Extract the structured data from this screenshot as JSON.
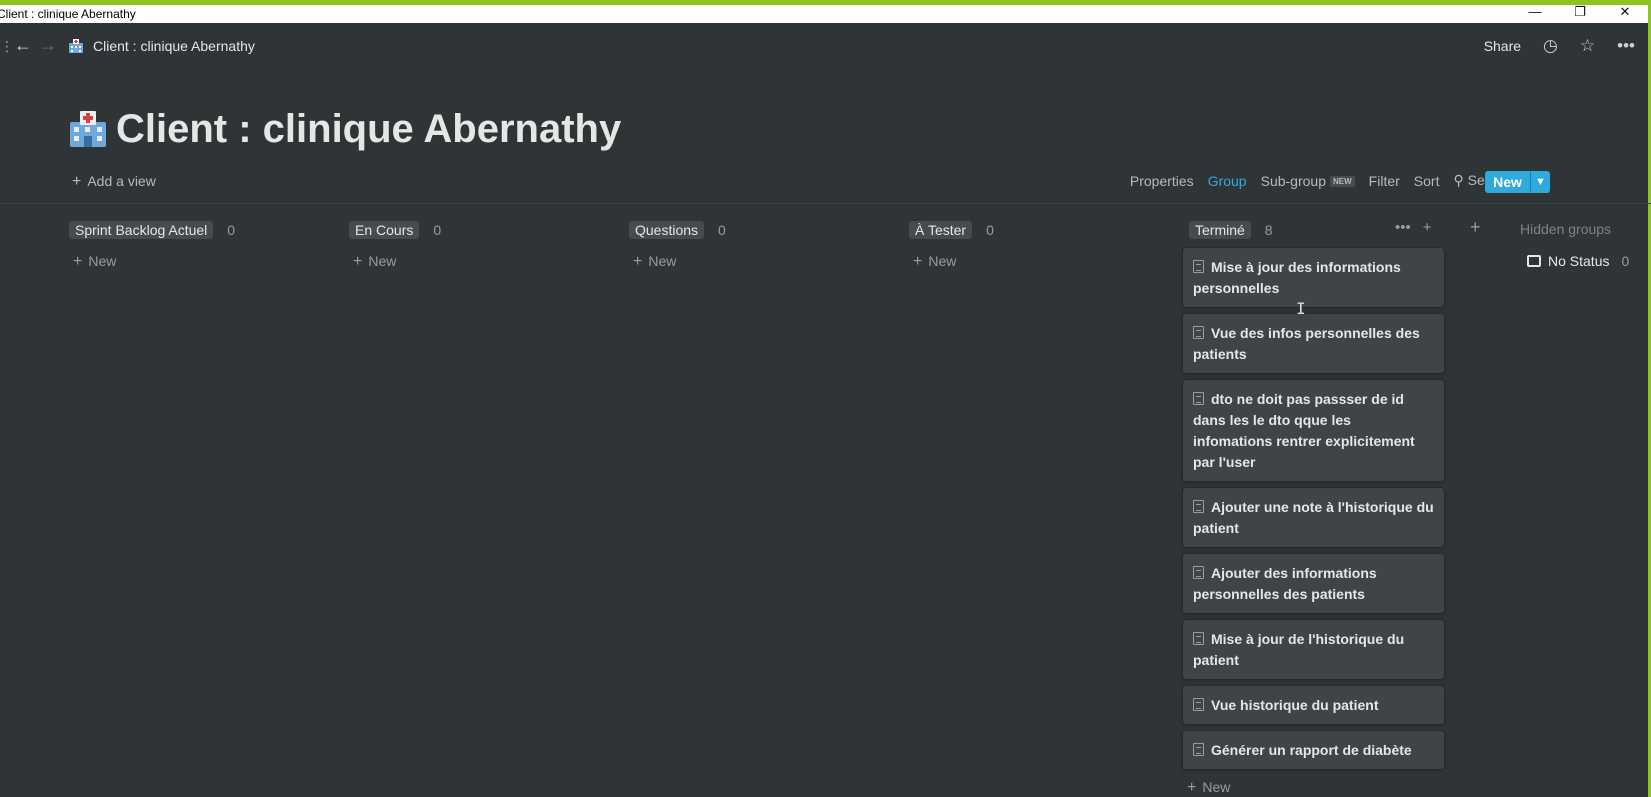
{
  "window": {
    "title": "Client : clinique Abernathy",
    "minimize": "—",
    "restore": "❐",
    "close": "✕"
  },
  "topbar": {
    "breadcrumb": "Client : clinique Abernathy",
    "share": "Share",
    "icons": [
      "history-icon",
      "star-icon",
      "more-icon"
    ]
  },
  "page": {
    "title": "Client : clinique Abernathy",
    "icon": "hospital-icon"
  },
  "viewbar": {
    "add_view": "Add a view",
    "properties": "Properties",
    "group": "Group",
    "subgroup": "Sub-group",
    "subgroup_badge": "NEW",
    "filter": "Filter",
    "sort": "Sort",
    "search": "Search",
    "more": "···",
    "new": "New"
  },
  "board": {
    "new_label": "New",
    "columns": [
      {
        "name": "Sprint Backlog Actuel",
        "count": "0"
      },
      {
        "name": "En Cours",
        "count": "0"
      },
      {
        "name": "Questions",
        "count": "0"
      },
      {
        "name": "À Tester",
        "count": "0"
      },
      {
        "name": "Terminé",
        "count": "8"
      }
    ],
    "done_cards": [
      "Mise à jour des informations personnelles",
      "Vue des infos personnelles des patients",
      "dto ne doit pas passser de id dans les le dto qque les infomations rentrer explicitement par l'user",
      "Ajouter une note à l'historique du patient",
      "Ajouter des informations personnelles des patients",
      "Mise à jour de l'historique du patient",
      "Vue historique du patient",
      "Générer un rapport de diabète"
    ],
    "hidden_groups": "Hidden groups",
    "no_status": {
      "label": "No Status",
      "count": "0"
    }
  },
  "colors": {
    "background": "#2f3437",
    "accent": "#2eaadc",
    "window_accent": "#8fc31f"
  }
}
